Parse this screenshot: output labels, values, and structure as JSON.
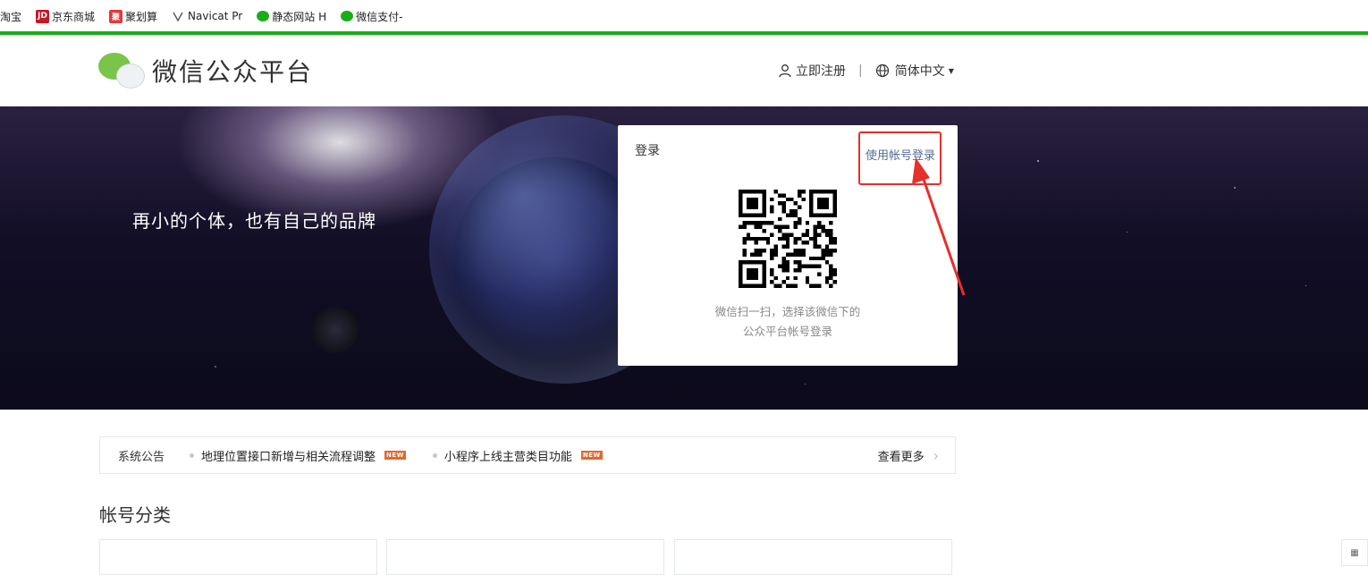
{
  "bookmarks": [
    {
      "label": "淘宝"
    },
    {
      "label": "京东商城",
      "icon_text": "JD"
    },
    {
      "label": "聚划算",
      "icon_text": "聚"
    },
    {
      "label": "Navicat Pr"
    },
    {
      "label": "静态网站 H"
    },
    {
      "label": "微信支付-"
    }
  ],
  "header": {
    "logo_text": "微信公众平台",
    "register_label": "立即注册",
    "separator": "|",
    "language_label": "简体中文"
  },
  "banner": {
    "slogan": "再小的个体，也有自己的品牌"
  },
  "login": {
    "title": "登录",
    "account_login_link": "使用帐号登录",
    "scan_hint_line1": "微信扫一扫，选择该微信下的",
    "scan_hint_line2": "公众平台帐号登录"
  },
  "notice": {
    "label": "系统公告",
    "items": [
      {
        "text": "地理位置接口新增与相关流程调整",
        "badge": "NEW"
      },
      {
        "text": "小程序上线主营类目功能",
        "badge": "NEW"
      }
    ],
    "more_label": "查看更多"
  },
  "categories": {
    "title": "帐号分类"
  },
  "colors": {
    "brand_green": "#1aad19",
    "link_blue": "#576b95",
    "highlight_red": "#e5302b",
    "badge_orange": "#e06a2c"
  }
}
